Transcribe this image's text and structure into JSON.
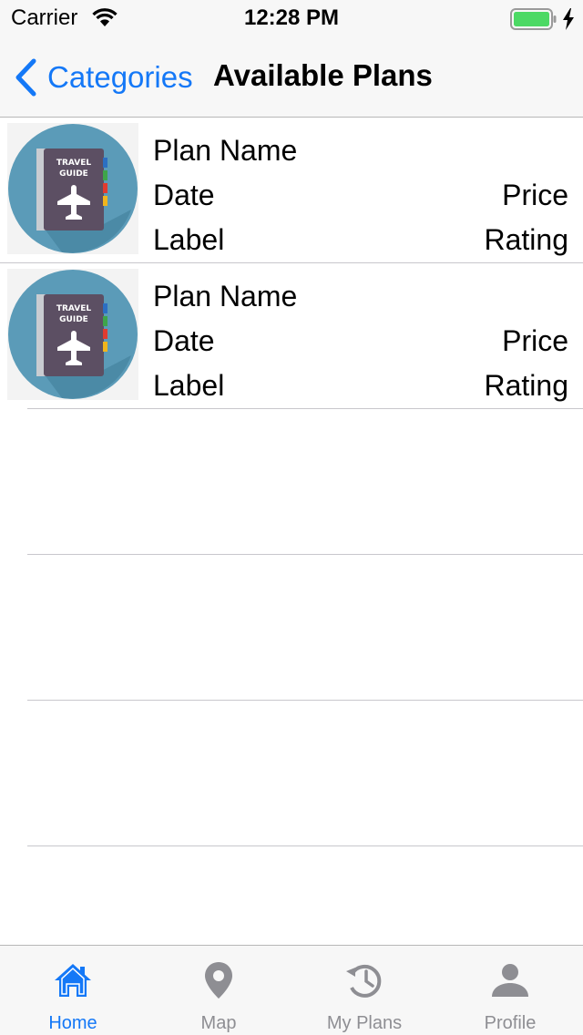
{
  "status_bar": {
    "carrier": "Carrier",
    "time": "12:28 PM",
    "icons": [
      "wifi-icon",
      "battery-icon",
      "charging-bolt-icon"
    ],
    "battery_color": "#4cd964"
  },
  "nav_bar": {
    "back_label": "Categories",
    "title": "Available Plans",
    "accent_color": "#1478f7"
  },
  "plans": [
    {
      "thumbnail_text_1": "TRAVEL",
      "thumbnail_text_2": "GUIDE",
      "name": "Plan Name",
      "date": "Date",
      "price": "Price",
      "label": "Label",
      "rating": "Rating"
    },
    {
      "thumbnail_text_1": "TRAVEL",
      "thumbnail_text_2": "GUIDE",
      "name": "Plan Name",
      "date": "Date",
      "price": "Price",
      "label": "Label",
      "rating": "Rating"
    }
  ],
  "tab_bar": {
    "selected": "Home",
    "items": [
      {
        "label": "Home",
        "icon": "home-icon"
      },
      {
        "label": "Map",
        "icon": "map-pin-icon"
      },
      {
        "label": "My Plans",
        "icon": "history-icon"
      },
      {
        "label": "Profile",
        "icon": "profile-icon"
      }
    ]
  }
}
